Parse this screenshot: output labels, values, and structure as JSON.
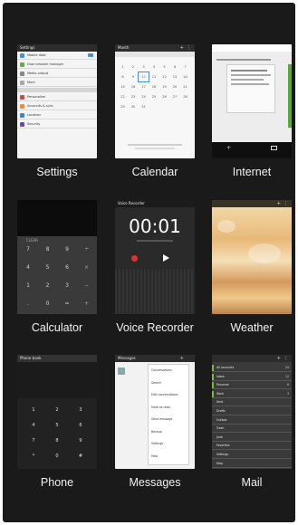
{
  "apps": [
    {
      "id": "settings",
      "label": "Settings"
    },
    {
      "id": "calendar",
      "label": "Calendar"
    },
    {
      "id": "internet",
      "label": "Internet"
    },
    {
      "id": "calculator",
      "label": "Calculator"
    },
    {
      "id": "voice_recorder",
      "label": "Voice Recorder"
    },
    {
      "id": "weather",
      "label": "Weather"
    },
    {
      "id": "phone",
      "label": "Phone"
    },
    {
      "id": "messages",
      "label": "Messages"
    },
    {
      "id": "mail",
      "label": "Mail"
    }
  ],
  "settings_thumb": {
    "title": "Settings",
    "rows": [
      "Mobile data",
      "Dual network manager",
      "Media output",
      "More"
    ],
    "section_rows": [
      "Personalize",
      "Accounts & sync",
      "Location",
      "Security"
    ]
  },
  "calendar_thumb": {
    "title": "Month",
    "days": [
      "1",
      "2",
      "3",
      "4",
      "5",
      "6",
      "7",
      "8",
      "9",
      "10",
      "11",
      "12",
      "13",
      "14",
      "15",
      "16",
      "17",
      "18",
      "19",
      "20",
      "21",
      "22",
      "23",
      "24",
      "25",
      "26",
      "27",
      "28",
      "29",
      "30",
      "31"
    ]
  },
  "calculator_thumb": {
    "display": "CLEAR",
    "keys": [
      "7",
      "8",
      "9",
      "÷",
      "4",
      "5",
      "6",
      "×",
      "1",
      "2",
      "3",
      "−",
      ".",
      "0",
      "=",
      "+"
    ]
  },
  "voice_recorder_thumb": {
    "title": "Voice Recorder",
    "time": "00:01"
  },
  "phone_thumb": {
    "title": "Phone book",
    "keys": [
      "1",
      "2",
      "3",
      "4",
      "5",
      "6",
      "7",
      "8",
      "9",
      "*",
      "0",
      "#"
    ]
  },
  "messages_thumb": {
    "title": "Messages",
    "menu": [
      "Conversations",
      "Search",
      "Edit conversations",
      "Mark as read",
      "Send message",
      "Backup",
      "Settings",
      "Help"
    ]
  },
  "mail_thumb": {
    "rows": [
      "All accounts",
      "Inbox",
      "Personal",
      "Work",
      "Sent",
      "Drafts",
      "Outbox",
      "Trash",
      "Junk",
      "Favorites",
      "Settings",
      "Help"
    ],
    "counts": [
      "24",
      "12",
      "6",
      "3",
      "",
      "",
      "",
      "",
      "",
      "",
      "",
      ""
    ]
  }
}
